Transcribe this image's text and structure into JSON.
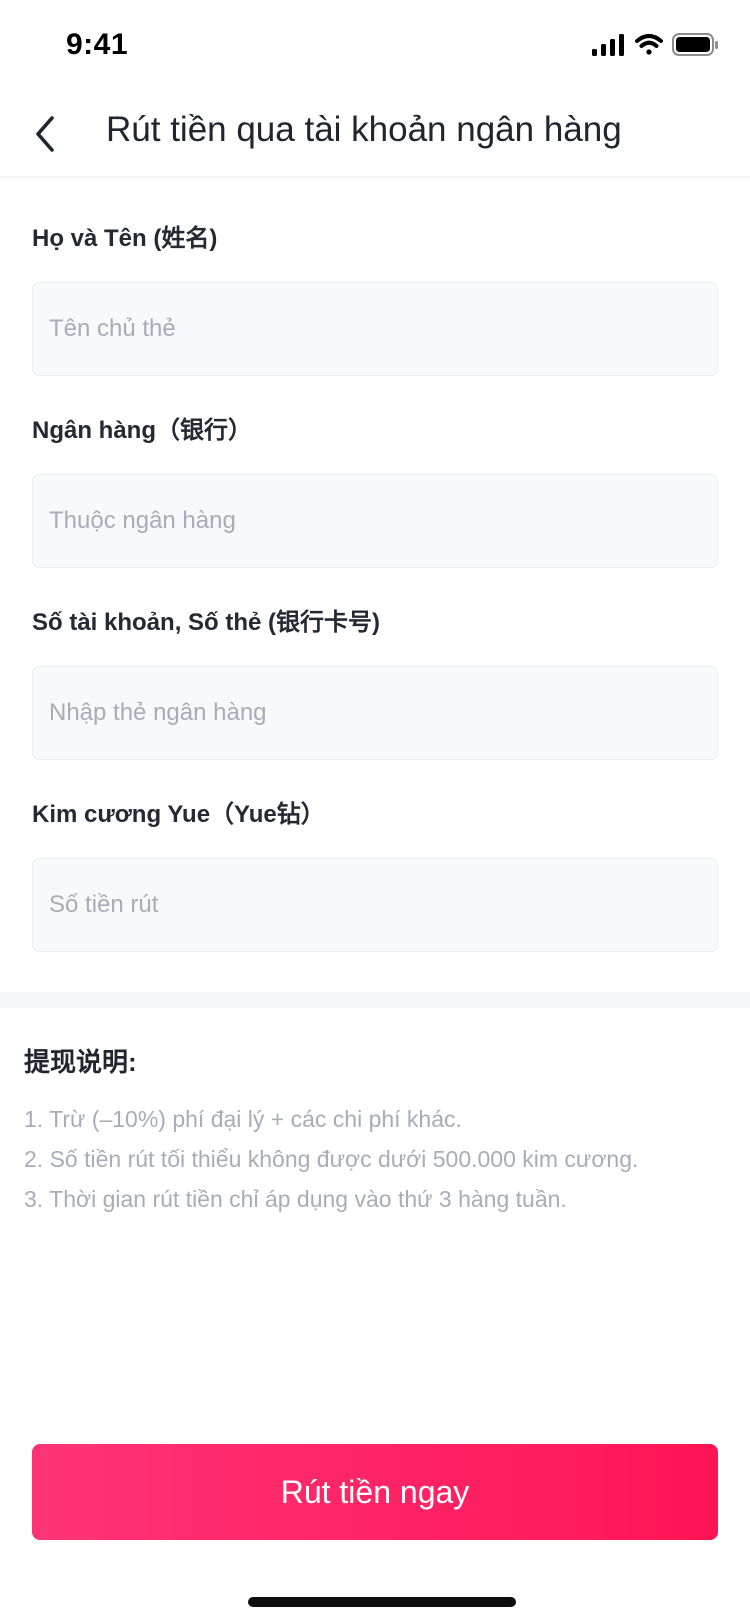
{
  "status_bar": {
    "time": "9:41",
    "icons": [
      "cellular-signal-icon",
      "wifi-icon",
      "battery-icon"
    ]
  },
  "nav": {
    "back_icon": "chevron-left-icon",
    "title": "Rút tiền qua tài khoản ngân hàng"
  },
  "form": {
    "fields": [
      {
        "label": "Họ và Tên (姓名)",
        "placeholder": "Tên chủ thẻ",
        "value": ""
      },
      {
        "label": "Ngân hàng（银行）",
        "placeholder": "Thuộc ngân hàng",
        "value": ""
      },
      {
        "label": "Số tài khoản, Số thẻ (银行卡号)",
        "placeholder": "Nhập thẻ ngân hàng",
        "value": ""
      },
      {
        "label": "Kim cương Yue（Yue钻）",
        "placeholder": "Số tiền rút",
        "value": ""
      }
    ]
  },
  "notes": {
    "title": "提现说明:",
    "items": [
      "1. Trừ (–10%) phí đại lý + các chi phí khác.",
      "2. Số tiền rút tối thiểu không được dưới 500.000 kim cương.",
      "3. Thời gian rút tiền chỉ áp dụng vào thứ 3 hàng tuần."
    ]
  },
  "actions": {
    "withdraw_label": "Rút tiền ngay"
  },
  "colors": {
    "accent_start": "#fe3477",
    "accent_end": "#ff1455",
    "placeholder": "#a8acb8",
    "input_bg": "#f8f9fb"
  }
}
